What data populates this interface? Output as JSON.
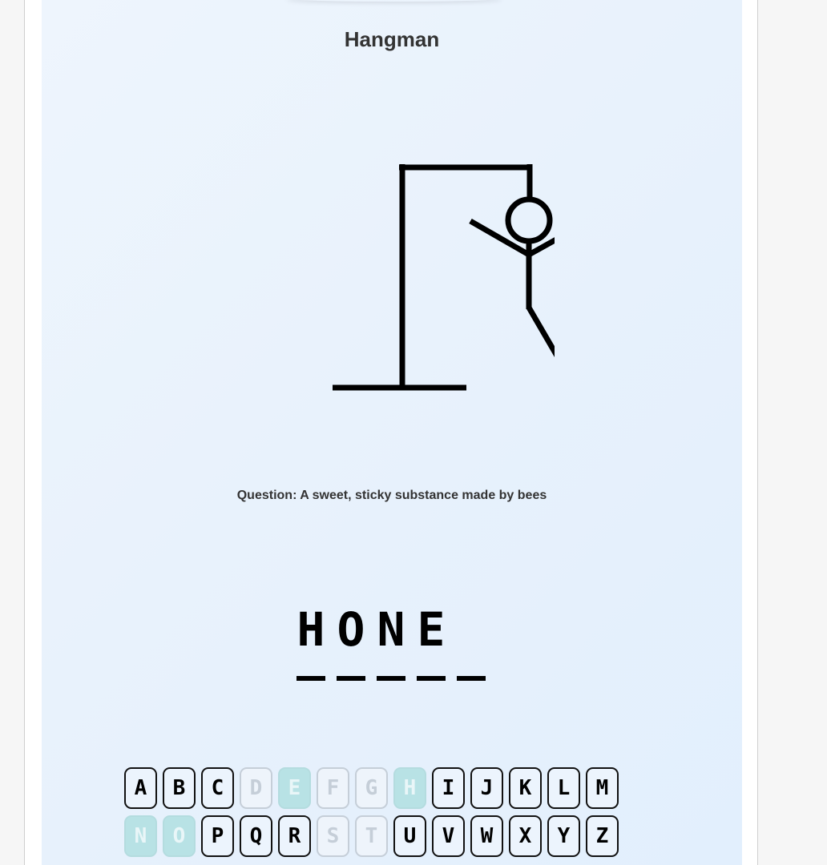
{
  "title": "Hangman",
  "question": "Question: A sweet, sticky substance made by bees",
  "word": [
    "H",
    "O",
    "N",
    "E",
    ""
  ],
  "wrong_guesses": 5,
  "max_wrong_guesses": 6,
  "keyboard": [
    [
      {
        "letter": "A",
        "state": "unused"
      },
      {
        "letter": "B",
        "state": "unused"
      },
      {
        "letter": "C",
        "state": "unused"
      },
      {
        "letter": "D",
        "state": "wrong"
      },
      {
        "letter": "E",
        "state": "correct"
      },
      {
        "letter": "F",
        "state": "wrong"
      },
      {
        "letter": "G",
        "state": "wrong"
      },
      {
        "letter": "H",
        "state": "correct"
      },
      {
        "letter": "I",
        "state": "unused"
      },
      {
        "letter": "J",
        "state": "unused"
      },
      {
        "letter": "K",
        "state": "unused"
      },
      {
        "letter": "L",
        "state": "unused"
      },
      {
        "letter": "M",
        "state": "unused"
      }
    ],
    [
      {
        "letter": "N",
        "state": "correct"
      },
      {
        "letter": "O",
        "state": "correct"
      },
      {
        "letter": "P",
        "state": "unused"
      },
      {
        "letter": "Q",
        "state": "unused"
      },
      {
        "letter": "R",
        "state": "unused"
      },
      {
        "letter": "S",
        "state": "wrong"
      },
      {
        "letter": "T",
        "state": "wrong"
      },
      {
        "letter": "U",
        "state": "unused"
      },
      {
        "letter": "V",
        "state": "unused"
      },
      {
        "letter": "W",
        "state": "unused"
      },
      {
        "letter": "X",
        "state": "unused"
      },
      {
        "letter": "Y",
        "state": "unused"
      },
      {
        "letter": "Z",
        "state": "unused"
      }
    ]
  ],
  "colors": {
    "correct_key": "#b8e2e5",
    "wrong_key_border": "#c5ced8",
    "drawing": "#000000"
  }
}
